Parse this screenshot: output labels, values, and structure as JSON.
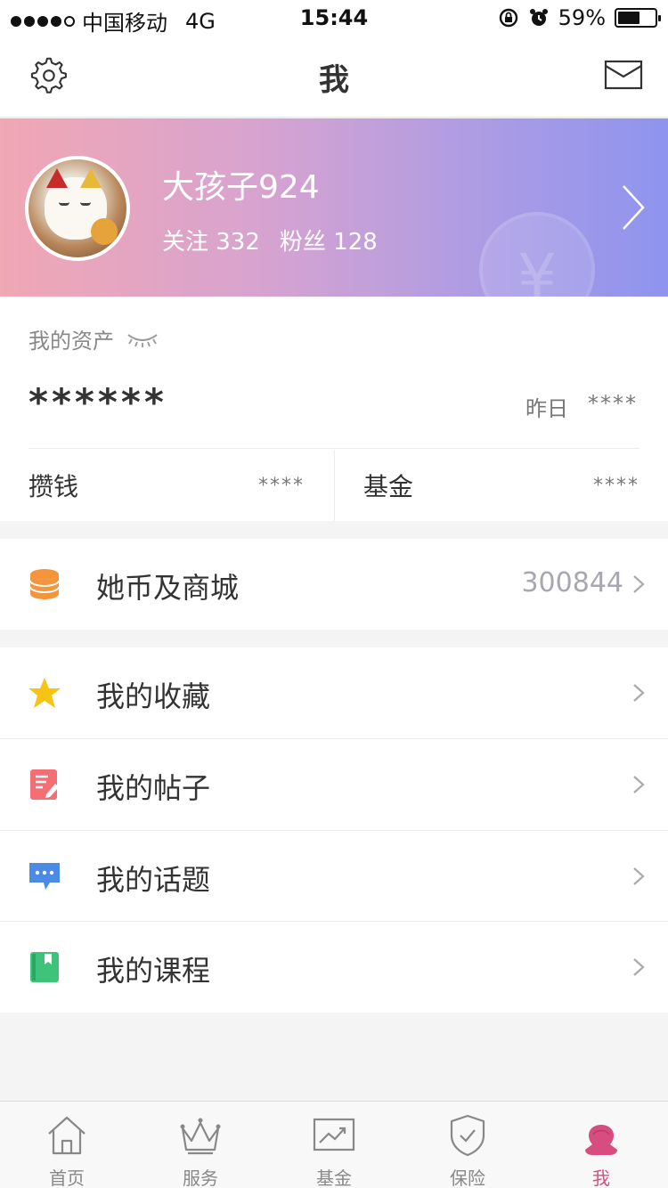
{
  "status_bar": {
    "carrier": "中国移动",
    "network": "4G",
    "time": "15:44",
    "battery": "59%",
    "battery_level": 0.59
  },
  "nav": {
    "title": "我",
    "icons": [
      "gear-icon",
      "mail-icon"
    ]
  },
  "profile": {
    "username": "大孩子924",
    "following_label": "关注 332",
    "followers_label": "粉丝 128",
    "coin_symbol": "¥"
  },
  "assets": {
    "label": "我的资产",
    "total": "******",
    "yesterday_label": "昨日",
    "yesterday_value": "****",
    "items": [
      {
        "label": "攒钱",
        "value": "****"
      },
      {
        "label": "基金",
        "value": "****"
      }
    ]
  },
  "coin_mall": {
    "label": "她币及商城",
    "value": "300844",
    "icon": "coin-stack-icon"
  },
  "menu": [
    {
      "label": "我的收藏",
      "icon": "star-icon"
    },
    {
      "label": "我的帖子",
      "icon": "post-edit-icon"
    },
    {
      "label": "我的话题",
      "icon": "chat-bubble-icon"
    },
    {
      "label": "我的课程",
      "icon": "course-book-icon"
    }
  ],
  "tabbar": [
    {
      "label": "首页",
      "icon": "home-icon"
    },
    {
      "label": "服务",
      "icon": "crown-icon"
    },
    {
      "label": "基金",
      "icon": "chart-icon"
    },
    {
      "label": "保险",
      "icon": "shield-icon"
    },
    {
      "label": "我",
      "icon": "user-icon",
      "active": true
    }
  ],
  "colors": {
    "accent": "#d84d7f",
    "gradient_start": "#f1a7b4",
    "gradient_end": "#8f94ee"
  }
}
